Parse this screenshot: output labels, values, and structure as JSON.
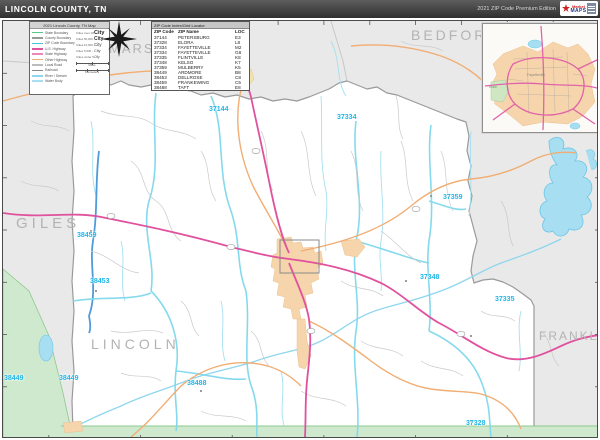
{
  "header": {
    "title": "LINCOLN COUNTY, TN",
    "edition": "2021 ZIP Code Premium Edition",
    "logo_line1": "Market",
    "logo_line2": "MAPS"
  },
  "legend": {
    "title": "2021 Lincoln County, TN Map",
    "line_items": [
      {
        "label": "State Boundary",
        "color": "#55c98a"
      },
      {
        "label": "County Boundary",
        "color": "#9a9a9a"
      },
      {
        "label": "ZIP Code Boundary",
        "color": "#43c6db"
      },
      {
        "label": "U.S. Highway",
        "color": "#e0519e"
      },
      {
        "label": "State Highway",
        "color": "#ee86bd"
      },
      {
        "label": "Other Highway",
        "color": "#f0ae74"
      },
      {
        "label": "Local Road",
        "color": "#bcbcbc"
      },
      {
        "label": "Railroad",
        "color": "#888888"
      },
      {
        "label": "River / Stream",
        "color": "#8fd6ee"
      },
      {
        "label": "Water Body",
        "color": "#a8def2"
      }
    ],
    "city_items": [
      {
        "label": "Cities over 100,000",
        "sample": "City"
      },
      {
        "label": "Cities 50,000 - 100,000",
        "sample": "City"
      },
      {
        "label": "Cities 10,000 - 50,000",
        "sample": "City"
      },
      {
        "label": "Cities 5,000 - 10,000",
        "sample": "City"
      },
      {
        "label": "Cities under 5,000",
        "sample": "City"
      }
    ],
    "scale_miles": "Miles",
    "scale_kilometers": "Kilometers"
  },
  "zip_table": {
    "title": "ZIP Code Index/Grid Locator",
    "columns": [
      "ZIP Code",
      "ZIP Name",
      "LOC"
    ],
    "rows": [
      [
        "37144",
        "PETERSBURG",
        "E3"
      ],
      [
        "37328",
        "ELORA",
        "L8"
      ],
      [
        "37334",
        "FAYETTEVILLE",
        "M2"
      ],
      [
        "37334",
        "FAYETTEVILLE",
        "G8"
      ],
      [
        "37335",
        "FLINTVILLE",
        "K8"
      ],
      [
        "37348",
        "KELSO",
        "K7"
      ],
      [
        "37359",
        "MULBERRY",
        "K5"
      ],
      [
        "38449",
        "ARDMORE",
        "B8"
      ],
      [
        "38453",
        "DELLROSE",
        "C8"
      ],
      [
        "38459",
        "FRANKEWING",
        "C5"
      ],
      [
        "38488",
        "TAFT",
        "E8"
      ]
    ]
  },
  "map": {
    "county_labels": [
      {
        "text": "MARSHALL"
      },
      {
        "text": "BEDFORD"
      },
      {
        "text": "GILES"
      },
      {
        "text": "LINCOLN"
      },
      {
        "text": "FRANKLIN"
      }
    ],
    "zip_labels": [
      {
        "text": "37144"
      },
      {
        "text": "37334"
      },
      {
        "text": "37359"
      },
      {
        "text": "37348"
      },
      {
        "text": "37335"
      },
      {
        "text": "38459"
      },
      {
        "text": "38453"
      },
      {
        "text": "38449"
      },
      {
        "text": "38449"
      },
      {
        "text": "38488"
      },
      {
        "text": "37328"
      }
    ],
    "colors": {
      "out_of_county": "#e9e9e9",
      "county_fill": "#ffffff",
      "state_fill_alabama": "#cfe9cf",
      "zip_label": "#1fb6e8",
      "county_label": "#b3b3b3",
      "us_highway": "#e0519e",
      "secondary_road": "#f0ae74",
      "zip_boundary": "#7fd8ec",
      "water": "#a8def2",
      "urban_area": "#f6d4ac"
    }
  },
  "inset": {
    "park_label": "PARK",
    "city_label": "Fayetteville"
  }
}
